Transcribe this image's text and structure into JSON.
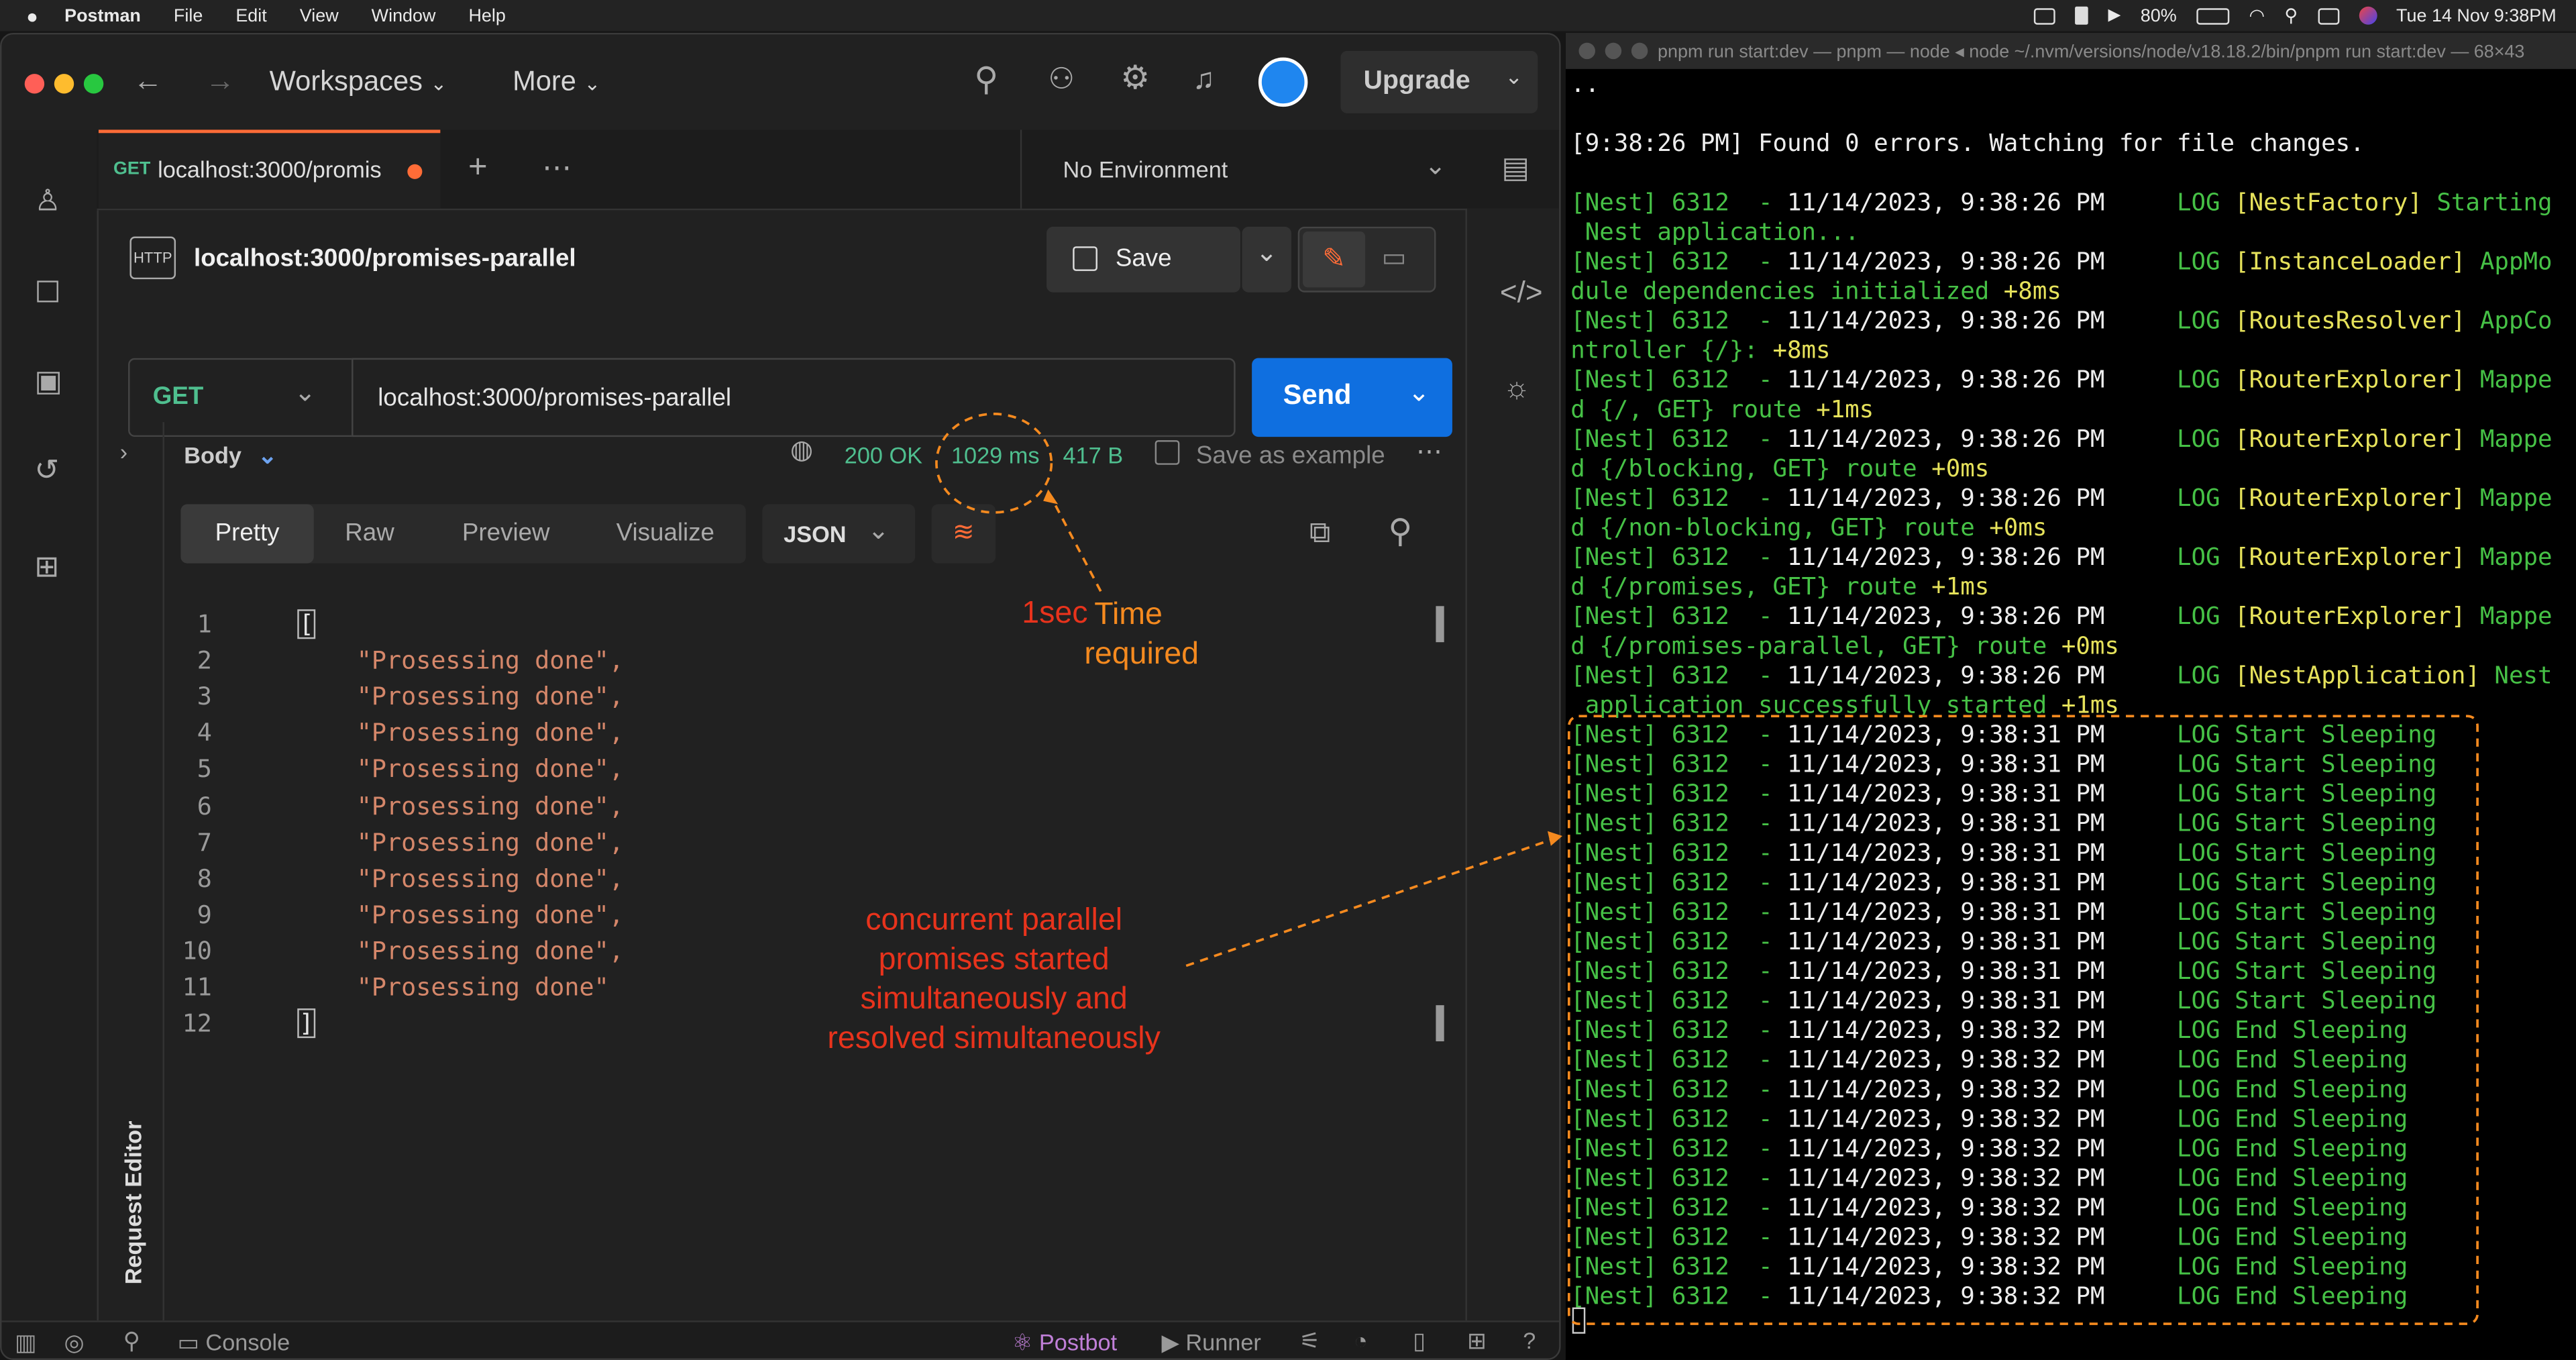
{
  "menubar": {
    "app": "Postman",
    "items": [
      "File",
      "Edit",
      "View",
      "Window",
      "Help"
    ],
    "battery": "80%",
    "datetime": "Tue 14 Nov  9:38PM"
  },
  "postman": {
    "workspaces": "Workspaces",
    "more": "More",
    "upgrade": "Upgrade",
    "tab": {
      "method": "GET",
      "title": "localhost:3000/promis"
    },
    "environment": "No Environment",
    "request_title": "localhost:3000/promises-parallel",
    "save": "Save",
    "method": "GET",
    "url": "localhost:3000/promises-parallel",
    "send": "Send",
    "response": {
      "body_label": "Body",
      "status": "200 OK",
      "time": "1029 ms",
      "size": "417 B",
      "save_example": "Save as example",
      "view_tabs": [
        "Pretty",
        "Raw",
        "Preview",
        "Visualize"
      ],
      "format": "JSON"
    },
    "code_lines": [
      {
        "n": "1",
        "t": "["
      },
      {
        "n": "2",
        "t": "    \"Prosessing done\","
      },
      {
        "n": "3",
        "t": "    \"Prosessing done\","
      },
      {
        "n": "4",
        "t": "    \"Prosessing done\","
      },
      {
        "n": "5",
        "t": "    \"Prosessing done\","
      },
      {
        "n": "6",
        "t": "    \"Prosessing done\","
      },
      {
        "n": "7",
        "t": "    \"Prosessing done\","
      },
      {
        "n": "8",
        "t": "    \"Prosessing done\","
      },
      {
        "n": "9",
        "t": "    \"Prosessing done\","
      },
      {
        "n": "10",
        "t": "    \"Prosessing done\","
      },
      {
        "n": "11",
        "t": "    \"Prosessing done\""
      },
      {
        "n": "12",
        "t": "]"
      }
    ],
    "request_editor": "Request Editor",
    "statusbar": {
      "console": "Console",
      "postbot": "Postbot",
      "runner": "Runner"
    }
  },
  "annotations": {
    "sec": "1sec",
    "time_required": [
      "Time",
      "required"
    ],
    "concurrent": [
      "concurrent parallel",
      "promises started",
      "simultaneously and",
      "resolved simultaneously"
    ]
  },
  "terminal": {
    "title": "pnpm run start:dev — pnpm — node ◂ node ~/.nvm/versions/node/v18.18.2/bin/pnpm run start:dev — 68×43",
    "lines": [
      [
        {
          "c": "w",
          "t": ".."
        }
      ],
      [
        {
          "c": "w",
          "t": ""
        }
      ],
      [
        {
          "c": "w",
          "t": "[9:38:26 PM] Found 0 errors. Watching for file changes."
        }
      ],
      [
        {
          "c": "w",
          "t": ""
        }
      ],
      [
        {
          "c": "g",
          "t": "[Nest] 6312  - "
        },
        {
          "c": "w",
          "t": "11/14/2023, 9:38:26 PM     "
        },
        {
          "c": "g",
          "t": "LOG "
        },
        {
          "c": "y",
          "t": "[NestFactory] "
        },
        {
          "c": "g",
          "t": "Starting"
        }
      ],
      [
        {
          "c": "g",
          "t": " Nest application..."
        }
      ],
      [
        {
          "c": "g",
          "t": "[Nest] 6312  - "
        },
        {
          "c": "w",
          "t": "11/14/2023, 9:38:26 PM     "
        },
        {
          "c": "g",
          "t": "LOG "
        },
        {
          "c": "y",
          "t": "[InstanceLoader] "
        },
        {
          "c": "g",
          "t": "AppMo"
        }
      ],
      [
        {
          "c": "g",
          "t": "dule dependencies initialized "
        },
        {
          "c": "y",
          "t": "+8ms"
        }
      ],
      [
        {
          "c": "g",
          "t": "[Nest] 6312  - "
        },
        {
          "c": "w",
          "t": "11/14/2023, 9:38:26 PM     "
        },
        {
          "c": "g",
          "t": "LOG "
        },
        {
          "c": "y",
          "t": "[RoutesResolver] "
        },
        {
          "c": "g",
          "t": "AppCo"
        }
      ],
      [
        {
          "c": "g",
          "t": "ntroller {/}: "
        },
        {
          "c": "y",
          "t": "+8ms"
        }
      ],
      [
        {
          "c": "g",
          "t": "[Nest] 6312  - "
        },
        {
          "c": "w",
          "t": "11/14/2023, 9:38:26 PM     "
        },
        {
          "c": "g",
          "t": "LOG "
        },
        {
          "c": "y",
          "t": "[RouterExplorer] "
        },
        {
          "c": "g",
          "t": "Mappe"
        }
      ],
      [
        {
          "c": "g",
          "t": "d {/, GET} route "
        },
        {
          "c": "y",
          "t": "+1ms"
        }
      ],
      [
        {
          "c": "g",
          "t": "[Nest] 6312  - "
        },
        {
          "c": "w",
          "t": "11/14/2023, 9:38:26 PM     "
        },
        {
          "c": "g",
          "t": "LOG "
        },
        {
          "c": "y",
          "t": "[RouterExplorer] "
        },
        {
          "c": "g",
          "t": "Mappe"
        }
      ],
      [
        {
          "c": "g",
          "t": "d {/blocking, GET} route "
        },
        {
          "c": "y",
          "t": "+0ms"
        }
      ],
      [
        {
          "c": "g",
          "t": "[Nest] 6312  - "
        },
        {
          "c": "w",
          "t": "11/14/2023, 9:38:26 PM     "
        },
        {
          "c": "g",
          "t": "LOG "
        },
        {
          "c": "y",
          "t": "[RouterExplorer] "
        },
        {
          "c": "g",
          "t": "Mappe"
        }
      ],
      [
        {
          "c": "g",
          "t": "d {/non-blocking, GET} route "
        },
        {
          "c": "y",
          "t": "+0ms"
        }
      ],
      [
        {
          "c": "g",
          "t": "[Nest] 6312  - "
        },
        {
          "c": "w",
          "t": "11/14/2023, 9:38:26 PM     "
        },
        {
          "c": "g",
          "t": "LOG "
        },
        {
          "c": "y",
          "t": "[RouterExplorer] "
        },
        {
          "c": "g",
          "t": "Mappe"
        }
      ],
      [
        {
          "c": "g",
          "t": "d {/promises, GET} route "
        },
        {
          "c": "y",
          "t": "+1ms"
        }
      ],
      [
        {
          "c": "g",
          "t": "[Nest] 6312  - "
        },
        {
          "c": "w",
          "t": "11/14/2023, 9:38:26 PM     "
        },
        {
          "c": "g",
          "t": "LOG "
        },
        {
          "c": "y",
          "t": "[RouterExplorer] "
        },
        {
          "c": "g",
          "t": "Mappe"
        }
      ],
      [
        {
          "c": "g",
          "t": "d {/promises-parallel, GET} route "
        },
        {
          "c": "y",
          "t": "+0ms"
        }
      ],
      [
        {
          "c": "g",
          "t": "[Nest] 6312  - "
        },
        {
          "c": "w",
          "t": "11/14/2023, 9:38:26 PM     "
        },
        {
          "c": "g",
          "t": "LOG "
        },
        {
          "c": "y",
          "t": "[NestApplication] "
        },
        {
          "c": "g",
          "t": "Nest"
        }
      ],
      [
        {
          "c": "g",
          "t": " application successfully started "
        },
        {
          "c": "y",
          "t": "+1ms"
        }
      ],
      [
        {
          "c": "g",
          "t": "[Nest] 6312  - "
        },
        {
          "c": "w",
          "t": "11/14/2023, 9:38:31 PM     "
        },
        {
          "c": "g",
          "t": "LOG Start Sleeping"
        }
      ],
      [
        {
          "c": "g",
          "t": "[Nest] 6312  - "
        },
        {
          "c": "w",
          "t": "11/14/2023, 9:38:31 PM     "
        },
        {
          "c": "g",
          "t": "LOG Start Sleeping"
        }
      ],
      [
        {
          "c": "g",
          "t": "[Nest] 6312  - "
        },
        {
          "c": "w",
          "t": "11/14/2023, 9:38:31 PM     "
        },
        {
          "c": "g",
          "t": "LOG Start Sleeping"
        }
      ],
      [
        {
          "c": "g",
          "t": "[Nest] 6312  - "
        },
        {
          "c": "w",
          "t": "11/14/2023, 9:38:31 PM     "
        },
        {
          "c": "g",
          "t": "LOG Start Sleeping"
        }
      ],
      [
        {
          "c": "g",
          "t": "[Nest] 6312  - "
        },
        {
          "c": "w",
          "t": "11/14/2023, 9:38:31 PM     "
        },
        {
          "c": "g",
          "t": "LOG Start Sleeping"
        }
      ],
      [
        {
          "c": "g",
          "t": "[Nest] 6312  - "
        },
        {
          "c": "w",
          "t": "11/14/2023, 9:38:31 PM     "
        },
        {
          "c": "g",
          "t": "LOG Start Sleeping"
        }
      ],
      [
        {
          "c": "g",
          "t": "[Nest] 6312  - "
        },
        {
          "c": "w",
          "t": "11/14/2023, 9:38:31 PM     "
        },
        {
          "c": "g",
          "t": "LOG Start Sleeping"
        }
      ],
      [
        {
          "c": "g",
          "t": "[Nest] 6312  - "
        },
        {
          "c": "w",
          "t": "11/14/2023, 9:38:31 PM     "
        },
        {
          "c": "g",
          "t": "LOG Start Sleeping"
        }
      ],
      [
        {
          "c": "g",
          "t": "[Nest] 6312  - "
        },
        {
          "c": "w",
          "t": "11/14/2023, 9:38:31 PM     "
        },
        {
          "c": "g",
          "t": "LOG Start Sleeping"
        }
      ],
      [
        {
          "c": "g",
          "t": "[Nest] 6312  - "
        },
        {
          "c": "w",
          "t": "11/14/2023, 9:38:31 PM     "
        },
        {
          "c": "g",
          "t": "LOG Start Sleeping"
        }
      ],
      [
        {
          "c": "g",
          "t": "[Nest] 6312  - "
        },
        {
          "c": "w",
          "t": "11/14/2023, 9:38:32 PM     "
        },
        {
          "c": "g",
          "t": "LOG End Sleeping"
        }
      ],
      [
        {
          "c": "g",
          "t": "[Nest] 6312  - "
        },
        {
          "c": "w",
          "t": "11/14/2023, 9:38:32 PM     "
        },
        {
          "c": "g",
          "t": "LOG End Sleeping"
        }
      ],
      [
        {
          "c": "g",
          "t": "[Nest] 6312  - "
        },
        {
          "c": "w",
          "t": "11/14/2023, 9:38:32 PM     "
        },
        {
          "c": "g",
          "t": "LOG End Sleeping"
        }
      ],
      [
        {
          "c": "g",
          "t": "[Nest] 6312  - "
        },
        {
          "c": "w",
          "t": "11/14/2023, 9:38:32 PM     "
        },
        {
          "c": "g",
          "t": "LOG End Sleeping"
        }
      ],
      [
        {
          "c": "g",
          "t": "[Nest] 6312  - "
        },
        {
          "c": "w",
          "t": "11/14/2023, 9:38:32 PM     "
        },
        {
          "c": "g",
          "t": "LOG End Sleeping"
        }
      ],
      [
        {
          "c": "g",
          "t": "[Nest] 6312  - "
        },
        {
          "c": "w",
          "t": "11/14/2023, 9:38:32 PM     "
        },
        {
          "c": "g",
          "t": "LOG End Sleeping"
        }
      ],
      [
        {
          "c": "g",
          "t": "[Nest] 6312  - "
        },
        {
          "c": "w",
          "t": "11/14/2023, 9:38:32 PM     "
        },
        {
          "c": "g",
          "t": "LOG End Sleeping"
        }
      ],
      [
        {
          "c": "g",
          "t": "[Nest] 6312  - "
        },
        {
          "c": "w",
          "t": "11/14/2023, 9:38:32 PM     "
        },
        {
          "c": "g",
          "t": "LOG End Sleeping"
        }
      ],
      [
        {
          "c": "g",
          "t": "[Nest] 6312  - "
        },
        {
          "c": "w",
          "t": "11/14/2023, 9:38:32 PM     "
        },
        {
          "c": "g",
          "t": "LOG End Sleeping"
        }
      ],
      [
        {
          "c": "g",
          "t": "[Nest] 6312  - "
        },
        {
          "c": "w",
          "t": "11/14/2023, 9:38:32 PM     "
        },
        {
          "c": "g",
          "t": "LOG End Sleeping"
        }
      ]
    ]
  },
  "colors": {
    "accent": "#ff6c37",
    "send": "#0f6fe0",
    "status_ok": "#4fbf8f",
    "annotation_red": "#e8331c",
    "annotation_orange": "#f58a1f",
    "log_green": "#46c146",
    "log_yellow": "#e6e25b"
  }
}
